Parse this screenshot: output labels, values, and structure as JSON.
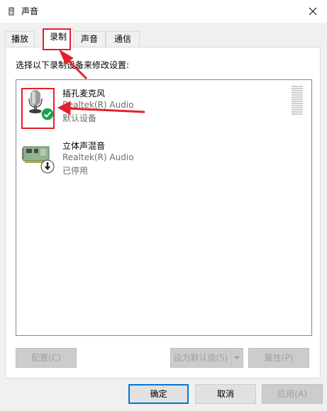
{
  "window": {
    "title": "声音",
    "title_icon": "speaker-icon",
    "close_icon": "close-icon"
  },
  "tabs": [
    {
      "label": "播放",
      "active": false
    },
    {
      "label": "录制",
      "active": true
    },
    {
      "label": "声音",
      "active": false
    },
    {
      "label": "通信",
      "active": false
    }
  ],
  "panel": {
    "instruction": "选择以下录制设备来修改设置:"
  },
  "devices": [
    {
      "name": "插孔麦克风",
      "driver": "Realtek(R) Audio",
      "status": "默认设备",
      "icon": "microphone-icon",
      "badge": "green-check-icon"
    },
    {
      "name": "立体声混音",
      "driver": "Realtek(R) Audio",
      "status": "已停用",
      "icon": "sound-card-icon",
      "badge": "disabled-down-arrow-icon"
    }
  ],
  "panel_buttons": {
    "configure": "配置(C)",
    "set_default": "设为默认值(S)",
    "properties": "属性(P)"
  },
  "dialog_buttons": {
    "ok": "确定",
    "cancel": "取消",
    "apply": "应用(A)"
  },
  "colors": {
    "accent": "#0078d7",
    "annotation": "#e4202a",
    "check_green": "#16a34a"
  }
}
